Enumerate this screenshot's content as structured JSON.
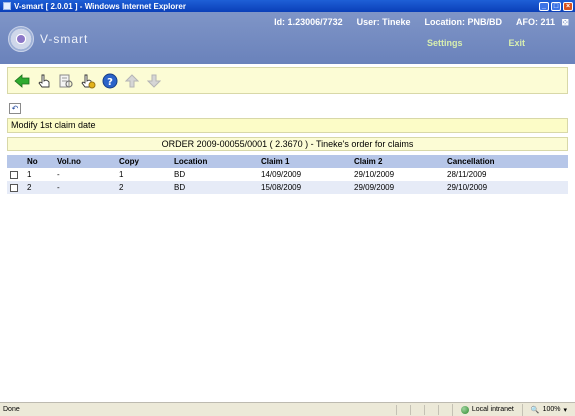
{
  "window": {
    "title": "V-smart [ 2.0.01 ] - Windows Internet Explorer"
  },
  "header": {
    "logo_text": "V-smart",
    "id_label": "Id: 1.23006/7732",
    "user_label": "User: Tineke",
    "location_label": "Location: PNB/BD",
    "afo_label": "AFO: 211",
    "settings_link": "Settings",
    "exit_link": "Exit"
  },
  "toolbar": {
    "icons": [
      "back-arrow-icon",
      "hand-select-icon",
      "document-view-icon",
      "hand-coin-icon",
      "help-icon",
      "arrow-up-icon",
      "arrow-down-icon"
    ]
  },
  "page": {
    "title": "Modify 1st claim date",
    "order_line": "ORDER 2009-00055/0001 ( 2.3670 ) - Tineke's order for claims"
  },
  "table": {
    "headers": [
      "No",
      "Vol.no",
      "Copy",
      "Location",
      "Claim 1",
      "Claim 2",
      "Cancellation"
    ],
    "rows": [
      [
        "1",
        "-",
        "1",
        "BD",
        "14/09/2009",
        "29/10/2009",
        "28/11/2009"
      ],
      [
        "2",
        "-",
        "2",
        "BD",
        "15/08/2009",
        "29/09/2009",
        "29/10/2009"
      ]
    ]
  },
  "statusbar": {
    "status": "Done",
    "zone": "Local intranet",
    "zoom": "100%"
  },
  "colors": {
    "header_bg": "#7086bf",
    "toolbar_bg": "#fcfcd5",
    "table_header_bg": "#b6c6e8",
    "link_green": "#d8efaf"
  }
}
